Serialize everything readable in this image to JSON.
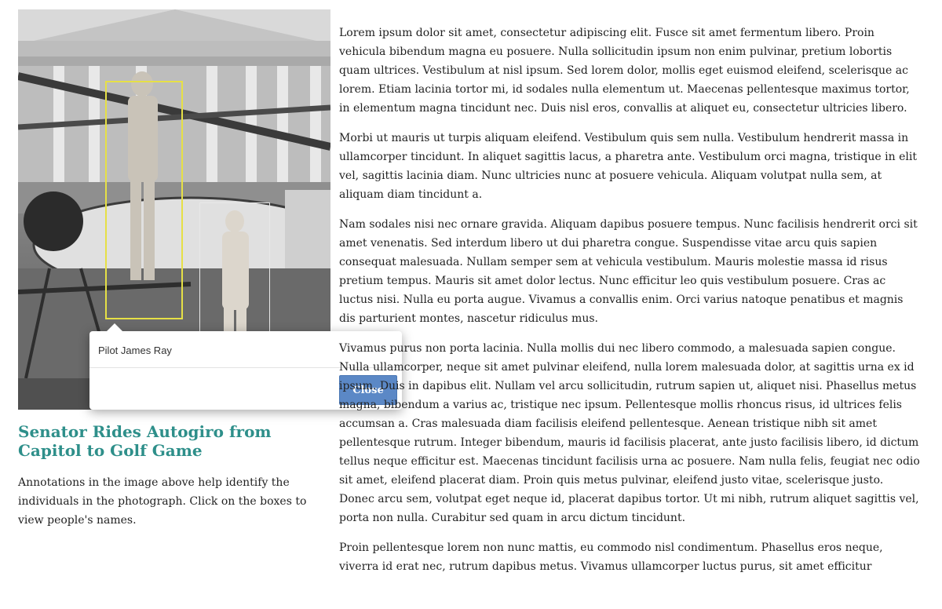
{
  "figure": {
    "annotations": [
      {
        "name": "Pilot James Ray"
      }
    ],
    "popover": {
      "label": "Pilot James Ray",
      "close_label": "Close"
    },
    "title": "Senator Rides Autogiro from Capitol to Golf Game",
    "caption": "Annotations in the image above help identify the individuals in the photograph. Click on the boxes to view people's names."
  },
  "article": {
    "paragraphs": [
      "Lorem ipsum dolor sit amet, consectetur adipiscing elit. Fusce sit amet fermentum libero. Proin vehicula bibendum magna eu posuere. Nulla sollicitudin ipsum non enim pulvinar, pretium lobortis quam ultrices. Vestibulum at nisl ipsum. Sed lorem dolor, mollis eget euismod eleifend, scelerisque ac lorem. Etiam lacinia tortor mi, id sodales nulla elementum ut. Maecenas pellentesque maximus tortor, in elementum magna tincidunt nec. Duis nisl eros, convallis at aliquet eu, consectetur ultricies libero.",
      "Morbi ut mauris ut turpis aliquam eleifend. Vestibulum quis sem nulla. Vestibulum hendrerit massa in ullamcorper tincidunt. In aliquet sagittis lacus, a pharetra ante. Vestibulum orci magna, tristique in elit vel, sagittis lacinia diam. Nunc ultricies nunc at posuere vehicula. Aliquam volutpat nulla sem, at aliquam diam tincidunt a.",
      "Nam sodales nisi nec ornare gravida. Aliquam dapibus posuere tempus. Nunc facilisis hendrerit orci sit amet venenatis. Sed interdum libero ut dui pharetra congue. Suspendisse vitae arcu quis sapien consequat malesuada. Nullam semper sem at vehicula vestibulum. Mauris molestie massa id risus pretium tempus. Mauris sit amet dolor lectus. Nunc efficitur leo quis vestibulum posuere. Cras ac luctus nisi. Nulla eu porta augue. Vivamus a convallis enim. Orci varius natoque penatibus et magnis dis parturient montes, nascetur ridiculus mus.",
      "Vivamus purus non porta lacinia. Nulla mollis dui nec libero commodo, a malesuada sapien congue. Nulla ullamcorper, neque sit amet pulvinar eleifend, nulla lorem malesuada dolor, at sagittis urna ex id ipsum. Duis in dapibus elit. Nullam vel arcu sollicitudin, rutrum sapien ut, aliquet nisi. Phasellus metus magna, bibendum a varius ac, tristique nec ipsum. Pellentesque mollis rhoncus risus, id ultrices felis accumsan a. Cras malesuada diam facilisis eleifend pellentesque. Aenean tristique nibh sit amet pellentesque rutrum. Integer bibendum, mauris id facilisis placerat, ante justo facilisis libero, id dictum tellus neque efficitur est. Maecenas tincidunt facilisis urna ac posuere. Nam nulla felis, feugiat nec odio sit amet, eleifend placerat diam. Proin quis metus pulvinar, eleifend justo vitae, scelerisque justo. Donec arcu sem, volutpat eget neque id, placerat dapibus tortor. Ut mi nibh, rutrum aliquet sagittis vel, porta non nulla. Curabitur sed quam in arcu dictum tincidunt.",
      "Proin pellentesque lorem non nunc mattis, eu commodo nisl condimentum. Phasellus eros neque, viverra id erat nec, rutrum dapibus metus. Vivamus ullamcorper luctus purus, sit amet efficitur"
    ]
  },
  "colors": {
    "title": "#2e8f8a",
    "close_button": "#5b88c6",
    "annotation_highlight": "#e6e046"
  }
}
